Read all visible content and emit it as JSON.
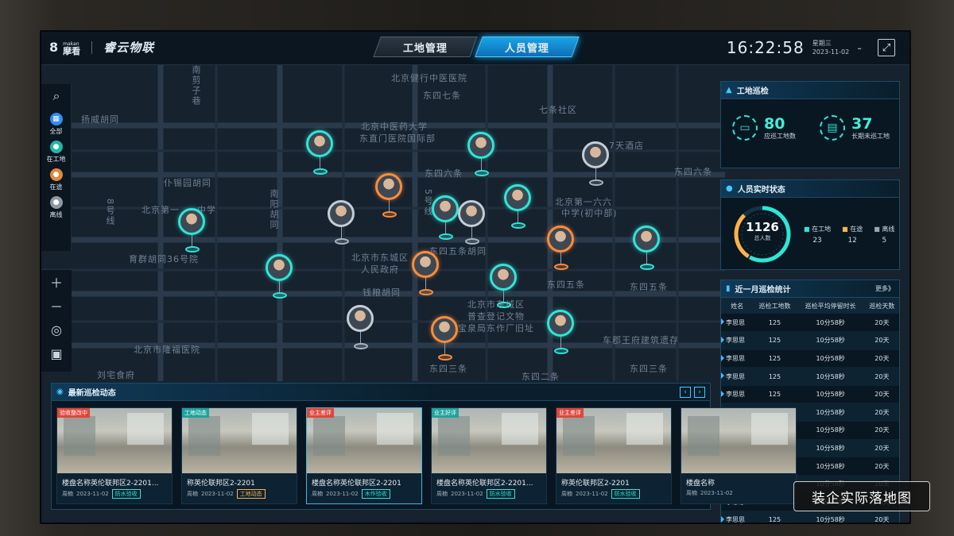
{
  "header": {
    "logo_sub": "makan",
    "logo_main": "摩看",
    "brand": "睿云物联",
    "tabs": [
      "工地管理",
      "人员管理"
    ],
    "active_tab": 1,
    "time": "16:22:58",
    "weekday": "星期三",
    "date": "2023-11-02"
  },
  "left_toolbar": {
    "items": [
      {
        "label": "全部"
      },
      {
        "label": "在工地"
      },
      {
        "label": "在途"
      },
      {
        "label": "离线"
      }
    ]
  },
  "map_labels": [
    "北京健行中医医院",
    "东四七条",
    "七条社区",
    "北京中医药大学",
    "东直门医院国际部",
    "7天酒店",
    "东四六条",
    "东四六条",
    "北京第一六六",
    "中学(初中部)",
    "北京第一",
    "中学",
    "育群胡同36号院",
    "北京市东城区",
    "人民政府",
    "东四五条胡同",
    "东四五条",
    "东四五条",
    "钱粮胡同",
    "北京市东城区",
    "普查登记文物",
    "宝泉局东作厂旧址",
    "北京市隆福医院",
    "车郡王府建筑遗存",
    "刘宅食府",
    "东四三条",
    "东四二条",
    "东四三条",
    "扬威胡同",
    "仆锡园胡同",
    "南阳胡同",
    "8号线",
    "5号线",
    "南剪子巷"
  ],
  "site_patrol": {
    "title": "工地巡检",
    "should": {
      "value": "80",
      "label": "应巡工地数"
    },
    "long": {
      "value": "37",
      "label": "长期未巡工地"
    }
  },
  "staff_status": {
    "title": "人员实时状态",
    "total": "1126",
    "total_label": "总人数",
    "legend": [
      {
        "label": "在工地",
        "value": "23",
        "color": "#2ee6d6"
      },
      {
        "label": "在途",
        "value": "12",
        "color": "#ffb347"
      },
      {
        "label": "离线",
        "value": "5",
        "color": "#9aa7b3"
      }
    ]
  },
  "monthly": {
    "title": "近一月巡检统计",
    "more": "更多》",
    "headers": [
      "姓名",
      "巡检工地数",
      "巡检平均停留时长",
      "巡检天数"
    ],
    "rows": [
      [
        "李思思",
        "125",
        "10分58秒",
        "20天"
      ],
      [
        "李思思",
        "125",
        "10分58秒",
        "20天"
      ],
      [
        "李思思",
        "125",
        "10分58秒",
        "20天"
      ],
      [
        "李思思",
        "125",
        "10分58秒",
        "20天"
      ],
      [
        "李思思",
        "125",
        "10分58秒",
        "20天"
      ],
      [
        "李思思",
        "125",
        "10分58秒",
        "20天"
      ],
      [
        "李思思",
        "125",
        "10分58秒",
        "20天"
      ],
      [
        "李思思",
        "125",
        "10分58秒",
        "20天"
      ],
      [
        "李思思",
        "125",
        "10分58秒",
        "20天"
      ],
      [
        "李思思",
        "125",
        "10分58秒",
        "20天"
      ],
      [
        "李思思",
        "125",
        "10分58秒",
        "20天"
      ],
      [
        "李思思",
        "125",
        "10分58秒",
        "20天"
      ]
    ]
  },
  "latest": {
    "title": "最新巡检动态",
    "cards": [
      {
        "tag": "验收整改中",
        "tag_color": "#e0463a",
        "title": "楼盘名称英伦联邦区2-2201...",
        "person": "周楠",
        "date": "2023-11-02",
        "badge": "防水验收",
        "badge_color": "#2ee6d6"
      },
      {
        "tag": "工地动态",
        "tag_color": "#1fa39b",
        "title": "称英伦联邦区2-2201",
        "person": "周楠",
        "date": "2023-11-02",
        "badge": "工地动态",
        "badge_color": "#ffb347"
      },
      {
        "tag": "业主差评",
        "tag_color": "#e0463a",
        "title": "楼盘名称英伦联邦区2-2201",
        "person": "周楠",
        "date": "2023-11-02",
        "badge": "木作验收",
        "badge_color": "#2ee6d6"
      },
      {
        "tag": "业主好评",
        "tag_color": "#1fa39b",
        "title": "楼盘名称英伦联邦区2-2201...",
        "person": "周楠",
        "date": "2023-11-02",
        "badge": "防水验收",
        "badge_color": "#2ee6d6"
      },
      {
        "tag": "业主差评",
        "tag_color": "#e0463a",
        "title": "称英伦联邦区2-2201",
        "person": "周楠",
        "date": "2023-11-02",
        "badge": "防水验收",
        "badge_color": "#2ee6d6"
      },
      {
        "tag": "",
        "tag_color": "#e0463a",
        "title": "楼盘名称",
        "person": "周楠",
        "date": "2023-11-02",
        "badge": "",
        "badge_color": "#2ee6d6"
      }
    ]
  },
  "caption": "装企实际落地图"
}
